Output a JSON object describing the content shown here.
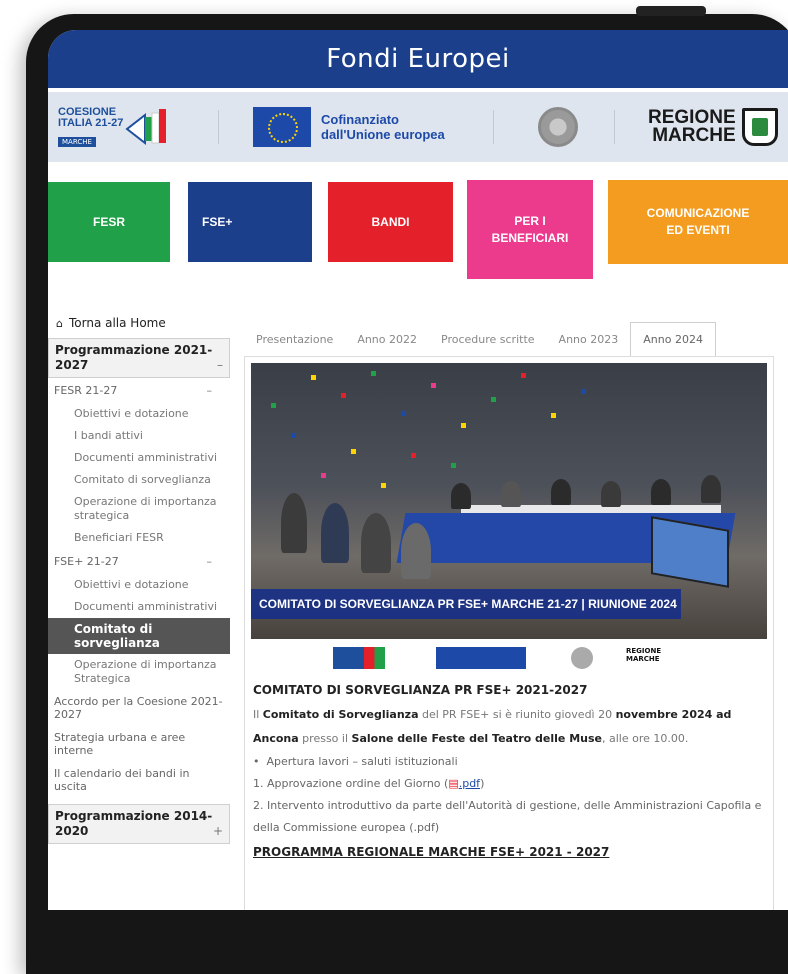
{
  "app": {
    "title": "Fondi Europei"
  },
  "logos": {
    "coesione": {
      "line1": "COESIONE",
      "line2": "ITALIA 21-27",
      "badge": "MARCHE"
    },
    "eu": {
      "line1": "Cofinanziato",
      "line2": "dall'Unione europea"
    },
    "marche": {
      "line1": "REGIONE",
      "line2": "MARCHE"
    }
  },
  "tiles": {
    "fesr": "FESR",
    "fse": "FSE+",
    "bandi": "BANDI",
    "beneficiari_1": "PER I",
    "beneficiari_2": "BENEFICIARI",
    "comunicazione_1": "COMUNICAZIONE",
    "comunicazione_2": "ED EVENTI"
  },
  "colors": {
    "title_bar": "#1b3f8b",
    "fesr": "#21a04a",
    "fse": "#1b3f8b",
    "bandi": "#e4202b",
    "beneficiari": "#ec3b8c",
    "comunicazione": "#f39c1f",
    "active_item": "#555555"
  },
  "sidebar": {
    "home": "Torna alla Home",
    "group_2021": "Programmazione 2021-2027",
    "toggle_minus": "–",
    "fesr_section": "FESR 21-27",
    "fesr_items": [
      "Obiettivi e dotazione",
      "I bandi attivi",
      "Documenti amministrativi",
      "Comitato di sorveglianza",
      "Operazione di importanza strategica",
      "Beneficiari FESR"
    ],
    "fse_section": "FSE+ 21-27",
    "fse_items": [
      "Obiettivi e dotazione",
      "Documenti amministrativi",
      "Comitato di sorveglianza",
      "Operazione di importanza Strategica"
    ],
    "other_items": [
      "Accordo per la Coesione 2021-2027",
      "Strategia urbana e aree interne",
      "Il calendario dei bandi in uscita"
    ],
    "group_2014": "Programmazione 2014-2020",
    "toggle_plus": "+"
  },
  "tabs": [
    "Presentazione",
    "Anno 2022",
    "Procedure scritte",
    "Anno 2023",
    "Anno 2024"
  ],
  "content": {
    "photo_caption": "COMITATO DI SORVEGLIANZA PR FSE+ MARCHE 21-27 | RIUNIONE 2024",
    "heading": "COMITATO DI SORVEGLIANZA PR FSE+ 2021-2027",
    "p1_a": "Il ",
    "p1_b": "Comitato di Sorveglianza",
    "p1_c": " del PR FSE+ si è riunito giovedì 20 ",
    "p1_d": "novembre 2024 ad Ancona",
    "p1_e": " presso il ",
    "p1_f": "Salone delle Feste del Teatro delle Muse",
    "p1_g": ", alle ore 10.00.",
    "bullet": "Apertura lavori – saluti istituzionali",
    "item1": "1.  Approvazione ordine del Giorno (",
    "item1_link": ".pdf",
    "item1_end": ")",
    "item2": "2.  Intervento introduttivo da parte dell'Autorità di gestione, delle Amministrazioni Capofila e della Commissione europea (.pdf)",
    "program_heading": "PROGRAMMA REGIONALE MARCHE FSE+ 2021 - 2027"
  }
}
